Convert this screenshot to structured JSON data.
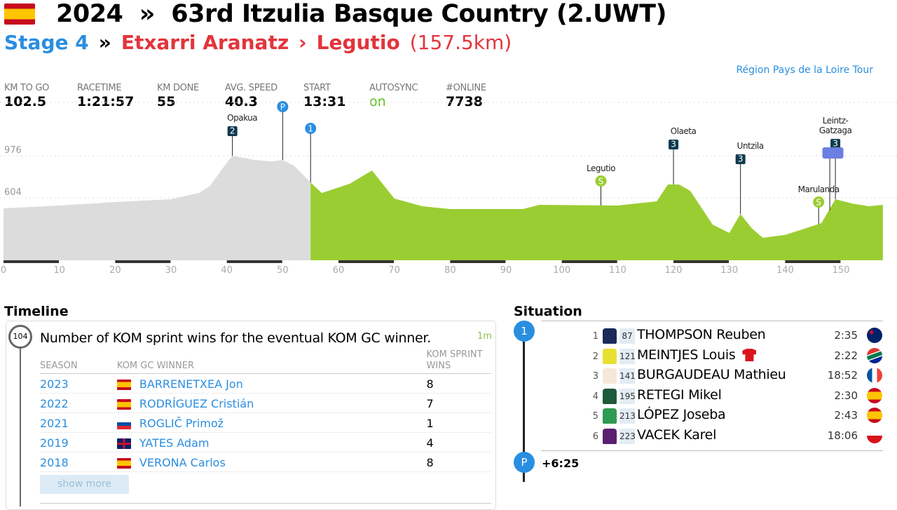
{
  "header": {
    "year": "2024",
    "arrow": "»",
    "race": "63rd Itzulia Basque Country (2.UWT)",
    "stage": "Stage 4",
    "stage_arrow": "»",
    "from": "Etxarri Aranatz",
    "to_arrow": "›",
    "to": "Legutio",
    "distance": "(157.5km)",
    "sponsor": "Région Pays de la Loire Tour"
  },
  "stats": [
    {
      "label": "KM TO GO",
      "value": "102.5"
    },
    {
      "label": "RACETIME",
      "value": "1:21:57"
    },
    {
      "label": "KM DONE",
      "value": "55"
    },
    {
      "label": "AVG. SPEED",
      "value": "40.3"
    },
    {
      "label": "START",
      "value": "13:31"
    },
    {
      "label": "AUTOSYNC",
      "value": "on"
    },
    {
      "label": "#ONLINE",
      "value": "7738"
    }
  ],
  "chart_data": {
    "type": "area",
    "xlabel": "",
    "ylabel": "",
    "xlim": [
      0,
      157.5
    ],
    "x_ticks": [
      0,
      10,
      20,
      30,
      40,
      50,
      60,
      70,
      80,
      90,
      100,
      110,
      120,
      130,
      140,
      150
    ],
    "y_ticks": [
      231,
      604,
      976
    ],
    "grid": true,
    "km_done": 55,
    "colors": {
      "done": "#dcdcdc",
      "todo": "#9acd32"
    },
    "profile": [
      [
        0,
        511
      ],
      [
        10,
        536
      ],
      [
        20,
        567
      ],
      [
        30,
        592
      ],
      [
        35,
        647
      ],
      [
        37,
        710
      ],
      [
        40,
        914
      ],
      [
        41,
        976
      ],
      [
        45,
        939
      ],
      [
        48,
        926
      ],
      [
        50,
        939
      ],
      [
        52,
        889
      ],
      [
        55,
        740
      ],
      [
        57,
        647
      ],
      [
        62,
        728
      ],
      [
        66,
        846
      ],
      [
        70,
        598
      ],
      [
        75,
        530
      ],
      [
        80,
        505
      ],
      [
        93,
        505
      ],
      [
        96,
        542
      ],
      [
        110,
        536
      ],
      [
        117,
        573
      ],
      [
        119,
        722
      ],
      [
        121,
        722
      ],
      [
        123,
        666
      ],
      [
        127,
        368
      ],
      [
        130,
        294
      ],
      [
        132,
        461
      ],
      [
        134,
        337
      ],
      [
        136,
        251
      ],
      [
        140,
        276
      ],
      [
        145,
        356
      ],
      [
        146.5,
        381
      ],
      [
        149,
        592
      ],
      [
        152,
        554
      ],
      [
        155,
        530
      ],
      [
        157.5,
        542
      ]
    ],
    "markers": [
      {
        "km": 41,
        "type": "kom",
        "badge": "2",
        "name": "Opakua"
      },
      {
        "km": 50,
        "type": "point",
        "badge": "P",
        "name": ""
      },
      {
        "km": 55,
        "type": "point",
        "badge": "1",
        "name": ""
      },
      {
        "km": 107,
        "type": "sprint",
        "badge": "S",
        "name": "Legutio"
      },
      {
        "km": 120,
        "type": "kom",
        "badge": "3",
        "name": "Olaeta"
      },
      {
        "km": 132,
        "type": "kom",
        "badge": "3",
        "name": "Untzila"
      },
      {
        "km": 146,
        "type": "sprint",
        "badge": "S",
        "name": "Marulanda"
      },
      {
        "km": 149,
        "type": "kom",
        "badge": "3",
        "name": "Leintz-Gatzaga"
      }
    ]
  },
  "timeline": {
    "title": "Timeline",
    "badge": "104",
    "question": "Number of KOM sprint wins for the eventual KOM GC winner.",
    "time": "1m",
    "columns": [
      "SEASON",
      "KOM GC WINNER",
      "KOM SPRINT WINS"
    ],
    "rows": [
      {
        "season": "2023",
        "flag": "es",
        "winner": "BARRENETXEA Jon",
        "wins": "8"
      },
      {
        "season": "2022",
        "flag": "es",
        "winner": "RODRÍGUEZ Cristián",
        "wins": "7"
      },
      {
        "season": "2021",
        "flag": "si",
        "winner": "ROGLIČ Primož",
        "wins": "1"
      },
      {
        "season": "2019",
        "flag": "gb",
        "winner": "YATES Adam",
        "wins": "4"
      },
      {
        "season": "2018",
        "flag": "es",
        "winner": "VERONA Carlos",
        "wins": "8"
      }
    ],
    "show_more": "show more"
  },
  "situation": {
    "title": "Situation",
    "group_badge": "1",
    "peloton_badge": "P",
    "peloton_gap": "+6:25",
    "riders": [
      {
        "pos": "1",
        "bib": "87",
        "name": "THOMPSON Reuben",
        "time": "2:35",
        "nat": "nz",
        "jersey": "#1a2a5a"
      },
      {
        "pos": "2",
        "bib": "121",
        "name": "MEINTJES Louis",
        "time": "2:22",
        "nat": "za",
        "jersey": "#e8e030",
        "kom_leader": true
      },
      {
        "pos": "3",
        "bib": "141",
        "name": "BURGAUDEAU Mathieu",
        "time": "18:52",
        "nat": "fr",
        "jersey": "#f4e8d8"
      },
      {
        "pos": "4",
        "bib": "195",
        "name": "RETEGI Mikel",
        "time": "2:30",
        "nat": "es",
        "jersey": "#1f5a3a"
      },
      {
        "pos": "5",
        "bib": "213",
        "name": "LÓPEZ Joseba",
        "time": "2:43",
        "nat": "es",
        "jersey": "#2e9a52"
      },
      {
        "pos": "6",
        "bib": "223",
        "name": "VACEK Karel",
        "time": "18:06",
        "nat": "cz",
        "jersey": "#5a2070"
      }
    ]
  }
}
